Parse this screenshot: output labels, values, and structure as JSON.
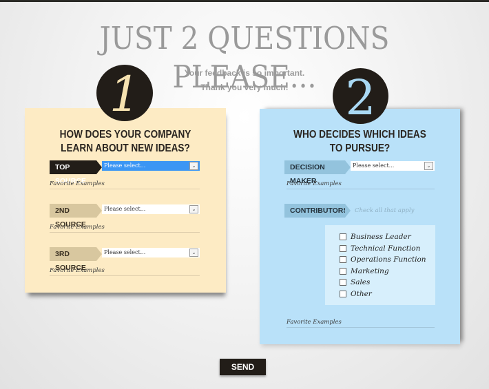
{
  "header": {
    "title": "JUST 2 QUESTIONS PLEASE...",
    "subtitle_line1": "Your feedback is so important.",
    "subtitle_line2": "Thank you very much!"
  },
  "question1": {
    "number": "1",
    "title_line1": "HOW DOES YOUR COMPANY",
    "title_line2": "LEARN ABOUT NEW IDEAS?",
    "rows": [
      {
        "label": "TOP SOURCE",
        "select_value": "Please select...",
        "examples_label": "Favorite Examples",
        "focused": true
      },
      {
        "label": "2ND SOURCE",
        "select_value": "Please select...",
        "examples_label": "Favorite Examples",
        "focused": false
      },
      {
        "label": "3RD SOURCE",
        "select_value": "Please select...",
        "examples_label": "Favorite Examples",
        "focused": false
      }
    ]
  },
  "question2": {
    "number": "2",
    "title_line1": "WHO DECIDES WHICH IDEAS",
    "title_line2": "TO PURSUE?",
    "decision_maker": {
      "label": "DECISION MAKER",
      "select_value": "Please select...",
      "examples_label": "Favorite Examples"
    },
    "contributors": {
      "label": "CONTRIBUTORS",
      "hint": "Check all that apply",
      "options": [
        {
          "label": "Business Leader",
          "checked": false
        },
        {
          "label": "Technical Function",
          "checked": false
        },
        {
          "label": "Operations Function",
          "checked": false
        },
        {
          "label": "Marketing",
          "checked": false
        },
        {
          "label": "Sales",
          "checked": false
        },
        {
          "label": "Other",
          "checked": false
        }
      ],
      "examples_label": "Favorite Examples"
    }
  },
  "footer": {
    "send_label": "SEND"
  },
  "icons": {
    "dropdown_arrow": "chevron-down-icon"
  },
  "colors": {
    "panel1_bg": "#fdebc4",
    "panel2_bg": "#b9e1f9",
    "dark": "#221d18",
    "select_focus": "#3b96f4"
  }
}
